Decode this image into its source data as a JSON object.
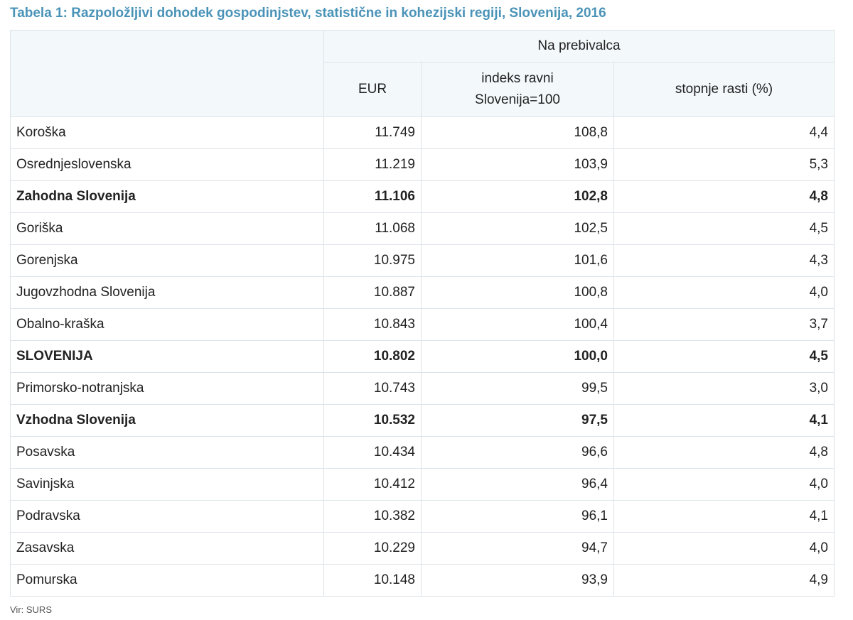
{
  "title": "Tabela 1: Razpoložljivi dohodek gospodinjstev, statistične in kohezijski regiji, Slovenija, 2016",
  "table": {
    "group_header": "Na prebivalca",
    "col_eur": "EUR",
    "col_index_line1": "indeks ravni",
    "col_index_line2": "Slovenija=100",
    "col_growth": "stopnje rasti (%)",
    "rows": [
      {
        "region": "Koroška",
        "eur": "11.749",
        "index": "108,8",
        "growth": "4,4",
        "bold": false
      },
      {
        "region": "Osrednjeslovenska",
        "eur": "11.219",
        "index": "103,9",
        "growth": "5,3",
        "bold": false
      },
      {
        "region": "Zahodna Slovenija",
        "eur": "11.106",
        "index": "102,8",
        "growth": "4,8",
        "bold": true
      },
      {
        "region": "Goriška",
        "eur": "11.068",
        "index": "102,5",
        "growth": "4,5",
        "bold": false
      },
      {
        "region": "Gorenjska",
        "eur": "10.975",
        "index": "101,6",
        "growth": "4,3",
        "bold": false
      },
      {
        "region": "Jugovzhodna Slovenija",
        "eur": "10.887",
        "index": "100,8",
        "growth": "4,0",
        "bold": false
      },
      {
        "region": "Obalno-kraška",
        "eur": "10.843",
        "index": "100,4",
        "growth": "3,7",
        "bold": false
      },
      {
        "region": "SLOVENIJA",
        "eur": "10.802",
        "index": "100,0",
        "growth": "4,5",
        "bold": true
      },
      {
        "region": "Primorsko-notranjska",
        "eur": "10.743",
        "index": "99,5",
        "growth": "3,0",
        "bold": false
      },
      {
        "region": "Vzhodna Slovenija",
        "eur": "10.532",
        "index": "97,5",
        "growth": "4,1",
        "bold": true
      },
      {
        "region": "Posavska",
        "eur": "10.434",
        "index": "96,6",
        "growth": "4,8",
        "bold": false
      },
      {
        "region": "Savinjska",
        "eur": "10.412",
        "index": "96,4",
        "growth": "4,0",
        "bold": false
      },
      {
        "region": "Podravska",
        "eur": "10.382",
        "index": "96,1",
        "growth": "4,1",
        "bold": false
      },
      {
        "region": "Zasavska",
        "eur": "10.229",
        "index": "94,7",
        "growth": "4,0",
        "bold": false
      },
      {
        "region": "Pomurska",
        "eur": "10.148",
        "index": "93,9",
        "growth": "4,9",
        "bold": false
      }
    ]
  },
  "source": "Vir: SURS"
}
